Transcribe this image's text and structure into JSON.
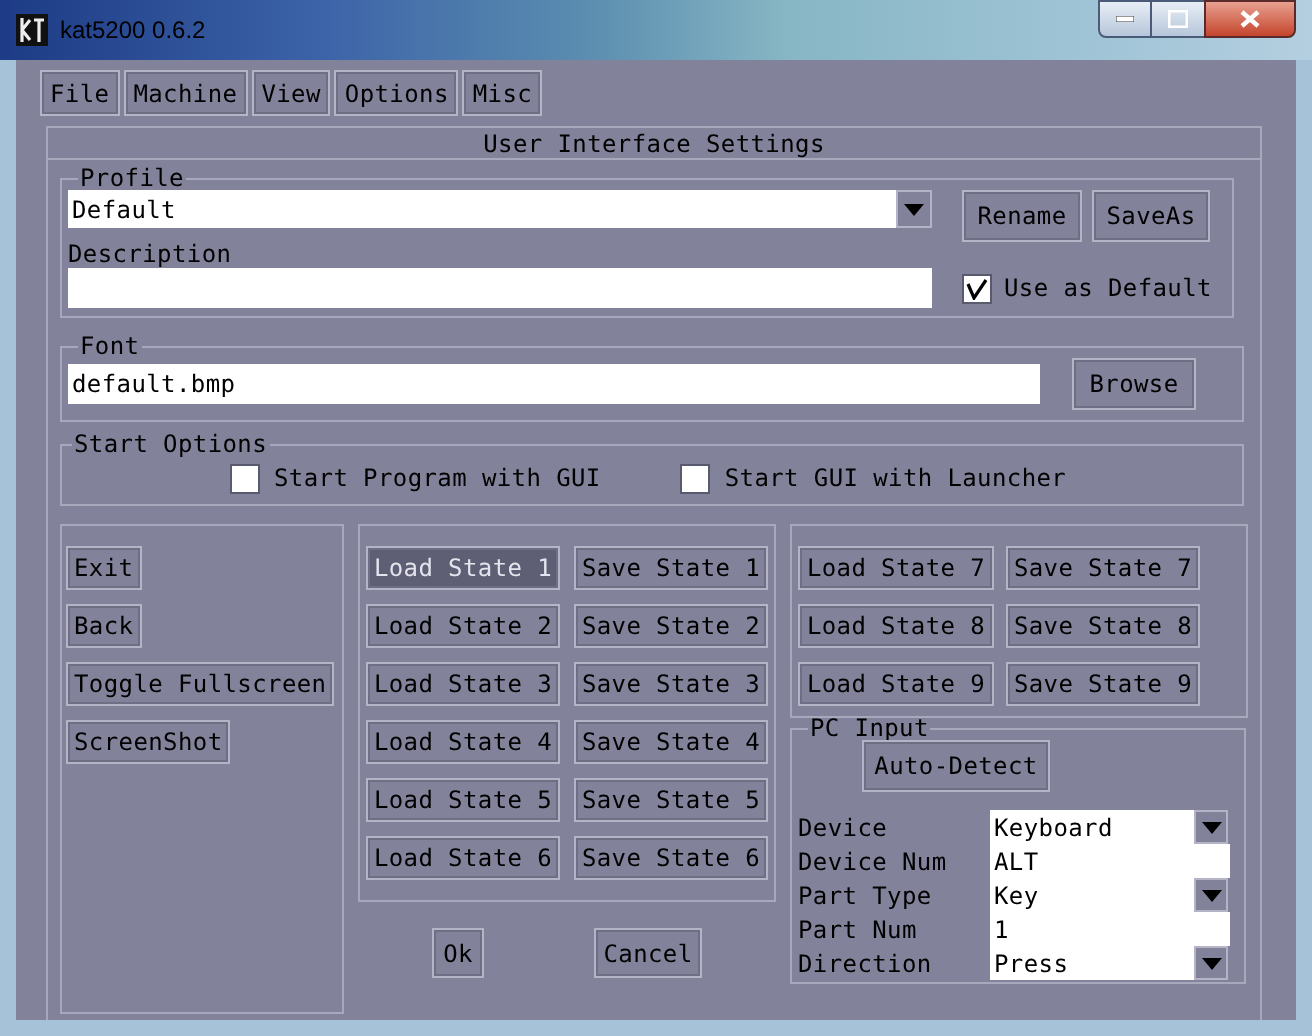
{
  "window": {
    "title": "kat5200 0.6.2"
  },
  "menu": [
    {
      "label": "File"
    },
    {
      "label": "Machine"
    },
    {
      "label": "View"
    },
    {
      "label": "Options"
    },
    {
      "label": "Misc"
    }
  ],
  "panel_title": "User Interface Settings",
  "profile": {
    "legend": "Profile",
    "value": "Default",
    "rename": "Rename",
    "save_as": "SaveAs",
    "description_label": "Description",
    "use_as_default": {
      "label": "Use as Default",
      "checked": true
    }
  },
  "font": {
    "legend": "Font",
    "value": "default.bmp",
    "browse": "Browse"
  },
  "start_options": {
    "legend": "Start Options",
    "options": [
      {
        "label": "Start Program with GUI",
        "checked": false
      },
      {
        "label": "Start GUI with Launcher",
        "checked": false
      }
    ]
  },
  "actions": [
    "Exit",
    "Back",
    "Toggle Fullscreen",
    "ScreenShot"
  ],
  "states_left": [
    {
      "load": "Load State 1",
      "save": "Save State 1",
      "selected": true
    },
    {
      "load": "Load State 2",
      "save": "Save State 2",
      "selected": false
    },
    {
      "load": "Load State 3",
      "save": "Save State 3",
      "selected": false
    },
    {
      "load": "Load State 4",
      "save": "Save State 4",
      "selected": false
    },
    {
      "load": "Load State 5",
      "save": "Save State 5",
      "selected": false
    },
    {
      "load": "Load State 6",
      "save": "Save State 6",
      "selected": false
    }
  ],
  "states_right": [
    {
      "load": "Load State 7",
      "save": "Save State 7",
      "selected": false
    },
    {
      "load": "Load State 8",
      "save": "Save State 8",
      "selected": false
    },
    {
      "load": "Load State 9",
      "save": "Save State 9",
      "selected": false
    }
  ],
  "dialog_buttons": [
    "Ok",
    "Cancel"
  ],
  "pc_input": {
    "legend": "PC Input",
    "auto_detect": "Auto-Detect",
    "fields": [
      {
        "label": "Device",
        "value": "Keyboard",
        "kind": "dropdown"
      },
      {
        "label": "Device Num",
        "value": "ALT",
        "kind": "text"
      },
      {
        "label": "Part Type",
        "value": "Key",
        "kind": "dropdown"
      },
      {
        "label": "Part Num",
        "value": "1",
        "kind": "text"
      },
      {
        "label": "Direction",
        "value": "Press",
        "kind": "dropdown"
      }
    ]
  }
}
